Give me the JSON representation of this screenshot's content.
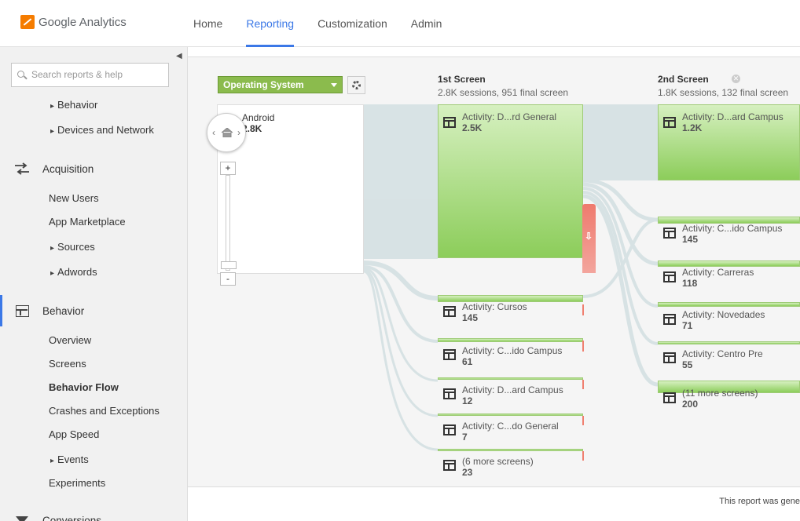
{
  "app": {
    "brand": "Google Analytics"
  },
  "nav": [
    "Home",
    "Reporting",
    "Customization",
    "Admin"
  ],
  "sidebar": {
    "search_placeholder": "Search reports & help",
    "items": [
      {
        "label": "Behavior",
        "kind": "arrow"
      },
      {
        "label": "Devices and Network",
        "kind": "arrow"
      },
      {
        "label": "Acquisition",
        "kind": "section"
      },
      {
        "label": "New Users",
        "kind": "sub"
      },
      {
        "label": "App Marketplace",
        "kind": "sub"
      },
      {
        "label": "Sources",
        "kind": "arrow"
      },
      {
        "label": "Adwords",
        "kind": "arrow"
      },
      {
        "label": "Behavior",
        "kind": "section"
      },
      {
        "label": "Overview",
        "kind": "sub"
      },
      {
        "label": "Screens",
        "kind": "sub"
      },
      {
        "label": "Behavior Flow",
        "kind": "sub-active"
      },
      {
        "label": "Crashes and Exceptions",
        "kind": "sub"
      },
      {
        "label": "App Speed",
        "kind": "sub"
      },
      {
        "label": "Events",
        "kind": "arrow"
      },
      {
        "label": "Experiments",
        "kind": "sub"
      },
      {
        "label": "Conversions",
        "kind": "section"
      }
    ]
  },
  "flow": {
    "dimension": "Operating System",
    "start_node": {
      "label": "Android",
      "count": "2.8K"
    },
    "columns": [
      {
        "title": "1st Screen",
        "subtitle": "2.8K sessions, 951 final screen"
      },
      {
        "title": "2nd Screen",
        "subtitle": "1.8K sessions, 132 final screen"
      }
    ],
    "screen1_nodes": [
      {
        "label": "Activity: D...rd General",
        "count": "2.5K"
      },
      {
        "label": "Activity: Cursos",
        "count": "145"
      },
      {
        "label": "Activity: C...ido Campus",
        "count": "61"
      },
      {
        "label": "Activity: D...ard Campus",
        "count": "12"
      },
      {
        "label": "Activity: C...do General",
        "count": "7"
      },
      {
        "label": "(6 more screens)",
        "count": "23"
      }
    ],
    "screen2_nodes": [
      {
        "label": "Activity: D...ard Campus",
        "count": "1.2K"
      },
      {
        "label": "Activity: C...ido Campus",
        "count": "145"
      },
      {
        "label": "Activity: Carreras",
        "count": "118"
      },
      {
        "label": "Activity: Novedades",
        "count": "71"
      },
      {
        "label": "Activity: Centro Pre",
        "count": "55"
      },
      {
        "label": "(11 more screens)",
        "count": "200"
      }
    ]
  },
  "footer": {
    "text": "This report was gene"
  },
  "colors": {
    "accent": "#3b78e7",
    "node_green": "#8ccd5a",
    "dropoff_red": "#ef7a6e",
    "dimension_green": "#8bbb4d"
  }
}
